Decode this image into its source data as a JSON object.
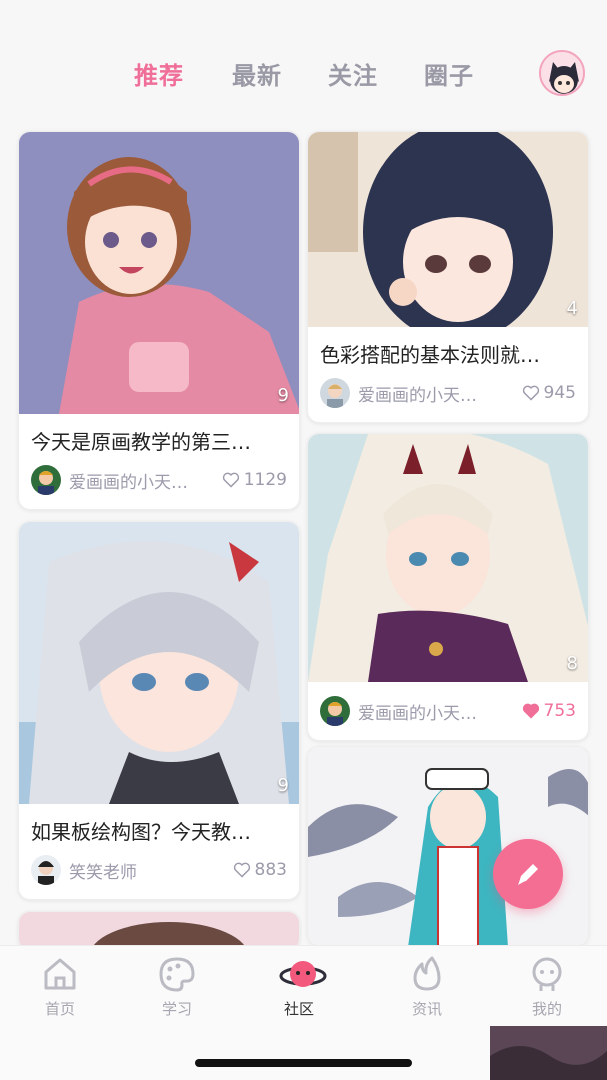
{
  "top_tabs": [
    {
      "label": "推荐",
      "active": true
    },
    {
      "label": "最新",
      "active": false
    },
    {
      "label": "关注",
      "active": false
    },
    {
      "label": "圈子",
      "active": false
    }
  ],
  "cards": [
    {
      "title": "今天是原画教学的第三…",
      "author": "爱画画的小天…",
      "likes": "1129",
      "liked": false,
      "count": "9"
    },
    {
      "title": "如果板绘构图？今天教…",
      "author": "笑笑老师",
      "likes": "883",
      "liked": false,
      "count": "9"
    },
    {
      "title": "色彩搭配的基本法则就…",
      "author": "爱画画的小天…",
      "likes": "945",
      "liked": false,
      "count": "4"
    },
    {
      "title": "",
      "author": "爱画画的小天…",
      "likes": "753",
      "liked": true,
      "count": "8"
    }
  ],
  "tabbar": [
    {
      "label": "首页",
      "icon": "home-icon",
      "active": false
    },
    {
      "label": "学习",
      "icon": "palette-icon",
      "active": false
    },
    {
      "label": "社区",
      "icon": "planet-icon",
      "active": true
    },
    {
      "label": "资讯",
      "icon": "flame-icon",
      "active": false
    },
    {
      "label": "我的",
      "icon": "face-icon",
      "active": false
    }
  ],
  "colors": {
    "accent": "#f06f98",
    "inactive": "#9a9aa6",
    "fab": "#f46d93"
  }
}
